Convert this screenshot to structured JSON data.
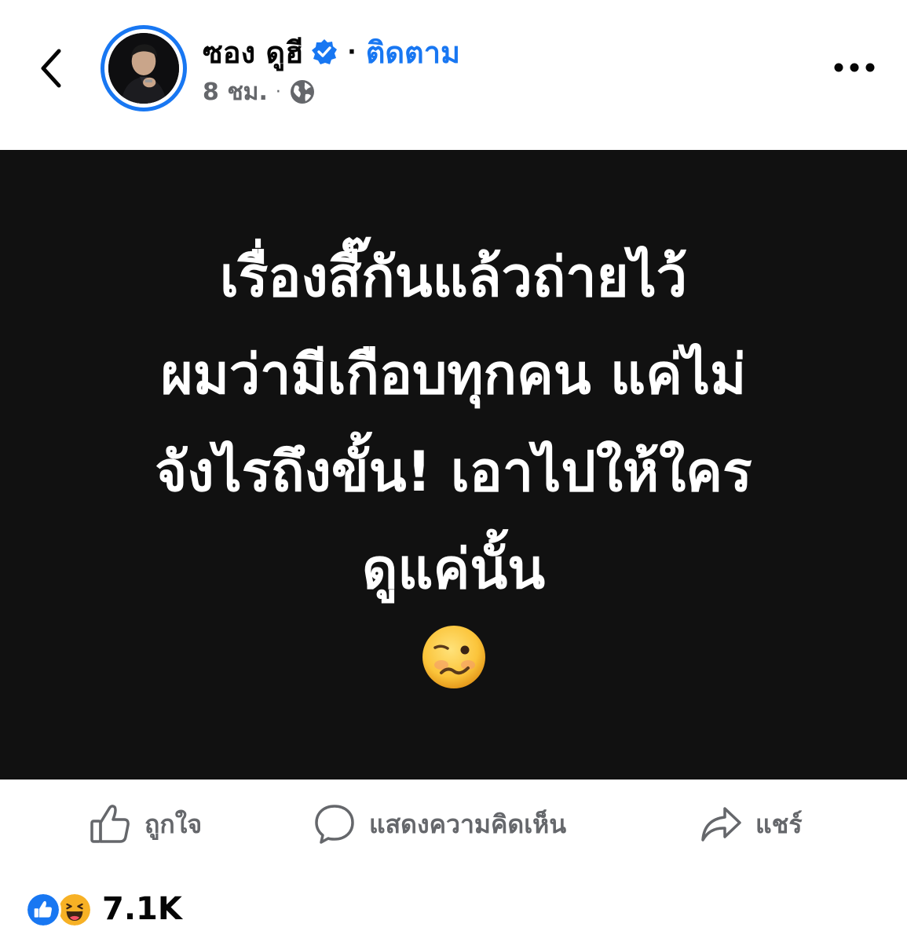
{
  "header": {
    "author_name": "ซอง ดูฮี",
    "separator": "·",
    "follow_label": "ติดตาม",
    "post_time": "8 ชม.",
    "meta_separator": "·",
    "verified_icon": "verified-badge-icon",
    "privacy_icon": "globe-icon",
    "back_icon": "chevron-left-icon",
    "more_icon": "more-dots-icon"
  },
  "post": {
    "lines": [
      "เรื่องสี๊กันแล้วถ่ายไว้",
      "ผมว่ามีเกือบทุกคน แค่ไม่",
      "จังไรถึงขั้น! เอาไปให้ใคร",
      "ดูแค่นั้น"
    ],
    "emoji_icon": "woozy-face-icon",
    "background_color": "#111111",
    "text_color": "#ffffff"
  },
  "actions": {
    "like_label": "ถูกใจ",
    "comment_label": "แสดงความคิดเห็น",
    "share_label": "แชร์"
  },
  "reactions": {
    "count": "7.1K",
    "icons": [
      "like-reaction-icon",
      "haha-reaction-icon"
    ]
  },
  "colors": {
    "accent": "#1877f2",
    "secondary_text": "#65676b",
    "primary_text": "#050505"
  }
}
